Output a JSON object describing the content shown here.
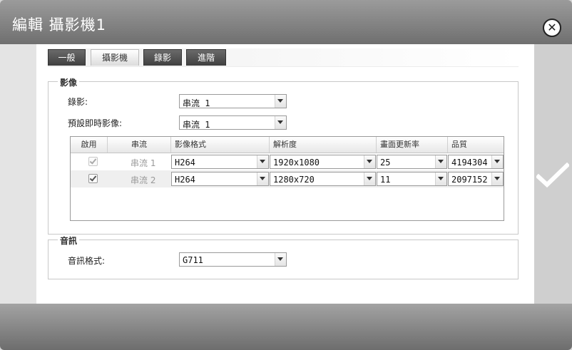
{
  "window": {
    "title": "編輯 攝影機1"
  },
  "tabs": [
    {
      "label": "一般"
    },
    {
      "label": "攝影機"
    },
    {
      "label": "錄影"
    },
    {
      "label": "進階"
    }
  ],
  "video": {
    "legend": "影像",
    "recording_label": "錄影:",
    "recording_value": "串流 1",
    "live_label": "預設即時影像:",
    "live_value": "串流 1",
    "columns": [
      "啟用",
      "串流",
      "影像格式",
      "解析度",
      "畫面更新率",
      "品質"
    ],
    "rows": [
      {
        "enabled": true,
        "stream": "串流 1",
        "format": "H264",
        "resolution": "1920x1080",
        "fps": "25",
        "quality": "4194304"
      },
      {
        "enabled": true,
        "stream": "串流 2",
        "format": "H264",
        "resolution": "1280x720",
        "fps": "11",
        "quality": "2097152"
      }
    ]
  },
  "audio": {
    "legend": "音訊",
    "format_label": "音訊格式:",
    "format_value": "G711"
  },
  "icons": {
    "close": "close-circle-icon",
    "confirm": "checkmark-icon"
  },
  "colors": {
    "titlebar": "#7f7f7f",
    "active_tab": "#ffffff",
    "inactive_tab": "#4a4a4a"
  }
}
